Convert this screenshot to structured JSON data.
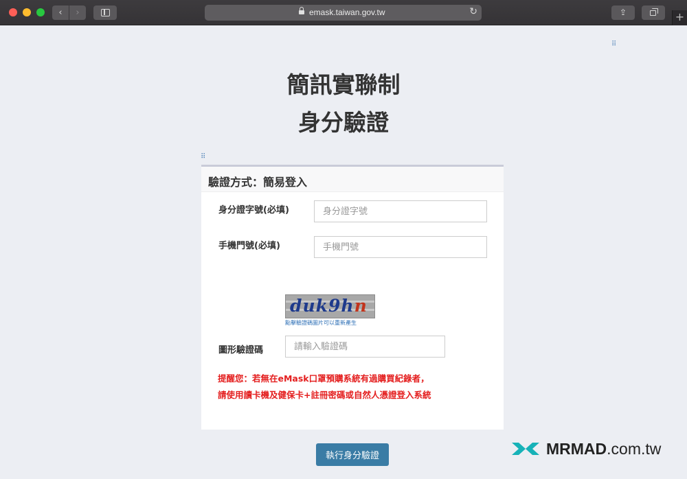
{
  "browser": {
    "url": "emask.taiwan.gov.tw"
  },
  "page": {
    "title_main": "簡訊實聯制",
    "title_sub": "身分驗證"
  },
  "card": {
    "heading": "驗證方式：簡易登入",
    "id_label": "身分證字號(必填)",
    "id_placeholder": "身分證字號",
    "phone_label": "手機門號(必填)",
    "phone_placeholder": "手機門號",
    "captcha_text_main": "duk9h",
    "captcha_text_last": "n",
    "captcha_hint": "點擊驗證碼圖片可以重新產生",
    "captcha_label": "圖形驗證碼",
    "captcha_placeholder": "請輸入驗證碼",
    "warning_line1": "提醒您：若無在eMask口罩預購系統有過購買紀錄者，",
    "warning_line2": "請使用讀卡機及健保卡+註冊密碼或自然人憑證登入系統"
  },
  "actions": {
    "submit_label": "執行身分驗證"
  },
  "watermark": {
    "brand": "MRMAD",
    "suffix": ".com.tw"
  },
  "colors": {
    "accent": "#3a7ca5",
    "warning": "#e41e1e",
    "link": "#2d6fb6"
  }
}
